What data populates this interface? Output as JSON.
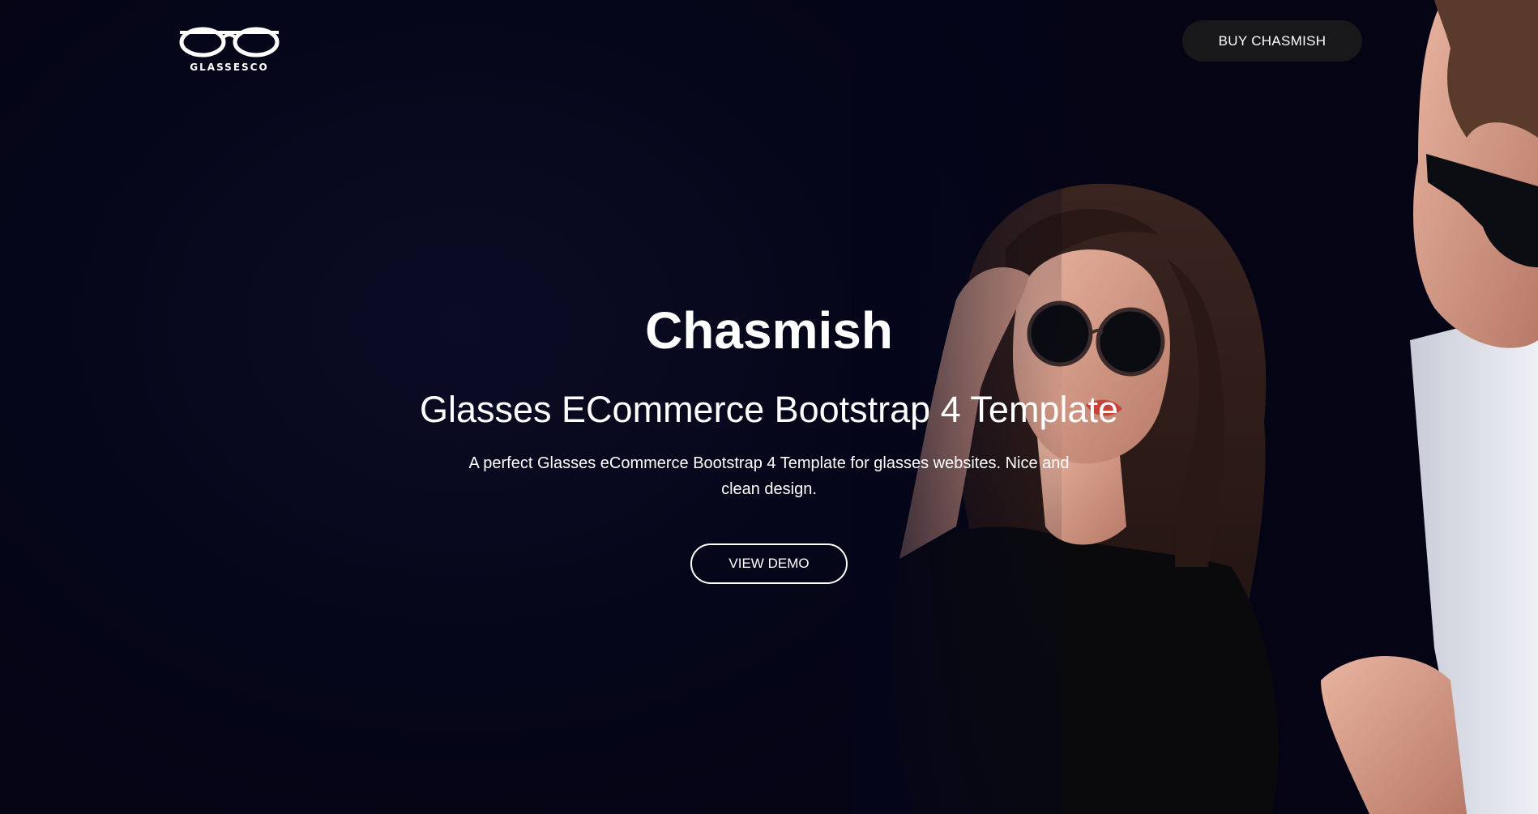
{
  "header": {
    "logo_text": "GLASSESCO",
    "buy_label": "BUY CHASMISH"
  },
  "hero": {
    "title": "Chasmish",
    "subtitle": "Glasses ECommerce Bootstrap 4 Template",
    "description": "A perfect Glasses eCommerce Bootstrap 4 Template for glasses websites. Nice and clean design.",
    "cta_label": "VIEW DEMO"
  },
  "colors": {
    "background": "#05051a",
    "text": "#ffffff",
    "buy_button_bg": "#18181a"
  }
}
